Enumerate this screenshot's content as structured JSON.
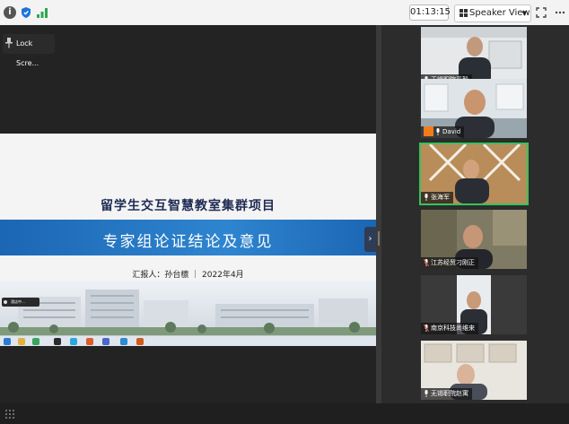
{
  "topbar": {
    "timer": "01:13:15",
    "view_label": "Speaker View"
  },
  "main": {
    "lock_label": "Lock Scre...",
    "slide": {
      "title": "留学生交互智慧教室集群项目",
      "banner": "专家组论证结论及意见",
      "reporter": "汇报人：孙台檩 ｜ 2022年4月"
    },
    "mini_badge": "酒店中..."
  },
  "participants": [
    {
      "name": "无锡职院平毅"
    },
    {
      "name": "David"
    },
    {
      "name": "张海军"
    },
    {
      "name": "江苏经贸刁刚正"
    },
    {
      "name": "南京科技尚维来"
    },
    {
      "name": "无锡职院赵寓"
    }
  ],
  "colors": {
    "accent_blue": "#1c66b4",
    "active_speaker": "#37c35b",
    "avatar_orange": "#f07c1b"
  }
}
